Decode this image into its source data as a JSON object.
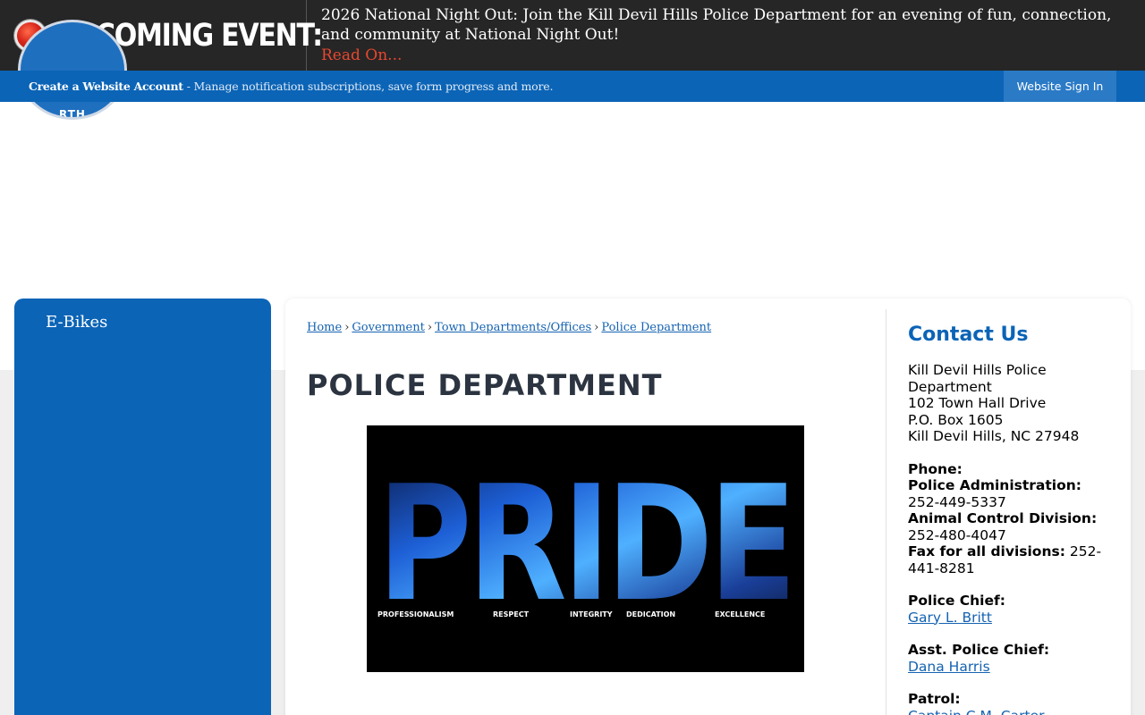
{
  "alert": {
    "heading": "UPCOMING EVENT:",
    "text": "2026 National Night Out: Join the Kill Devil Hills Police Department for an evening of fun, connection, and community at National Night Out!",
    "link": "Read On...",
    "link_color": "#e8472f"
  },
  "account_bar": {
    "create_link": "Create a Website Account",
    "description": "- Manage notification subscriptions, save form progress and more.",
    "signin": "Website Sign In",
    "bg_color": "#0b64b6"
  },
  "logo": {
    "text": "RTH CAROL",
    "icon": "town-seal-logo"
  },
  "sidebar": {
    "items": [
      {
        "label": "E-Bikes"
      }
    ]
  },
  "breadcrumb": [
    {
      "label": "Home"
    },
    {
      "label": "Government"
    },
    {
      "label": "Town Departments/Offices"
    },
    {
      "label": "Police Department"
    }
  ],
  "breadcrumb_separator": "›",
  "page_title": "POLICE DEPARTMENT",
  "hero": {
    "word": "PRIDE",
    "values": [
      "PROFESSIONALISM",
      "RESPECT",
      "INTEGRITY",
      "DEDICATION",
      "EXCELLENCE"
    ]
  },
  "contact": {
    "title": "Contact Us",
    "address": [
      "Kill Devil Hills Police Department",
      "102 Town Hall Drive",
      "P.O. Box 1605",
      "Kill Devil Hills, NC 27948"
    ],
    "phone_label": "Phone:",
    "admin_label": "Police Administration:",
    "admin_phone": "252-449-5337",
    "animal_label": "Animal Control Division:",
    "animal_phone": "252-480-4047",
    "fax_label": "Fax for all divisions:",
    "fax_phone": "252-441-8281",
    "chief_label": "Police Chief:",
    "chief_name": "Gary L. Britt",
    "asst_label": "Asst. Police Chief:",
    "asst_name": "Dana Harris",
    "patrol_label": "Patrol:",
    "patrol_name": "Captain C.M. Carter"
  }
}
